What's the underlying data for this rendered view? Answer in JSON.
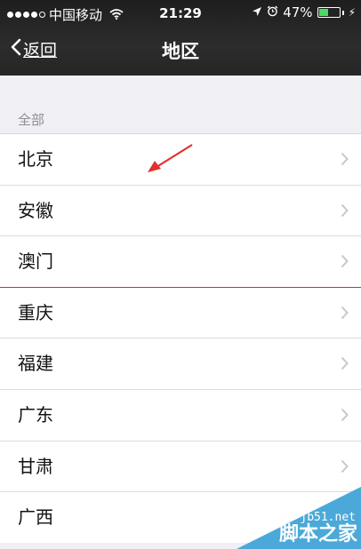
{
  "status_bar": {
    "carrier": "中国移动",
    "time": "21:29",
    "battery_percent": "47%",
    "battery_level": 0.47
  },
  "nav": {
    "back_label": "返回",
    "title": "地区"
  },
  "section": {
    "header": "全部"
  },
  "regions": [
    "北京",
    "安徽",
    "澳门",
    "重庆",
    "福建",
    "广东",
    "甘肃",
    "广西"
  ],
  "watermark": {
    "url": "jb51.net",
    "name": "脚本之家"
  },
  "colors": {
    "accent_green": "#4cd964",
    "annotation_red": "#e0302b",
    "watermark_blue": "#4aa9d8"
  }
}
